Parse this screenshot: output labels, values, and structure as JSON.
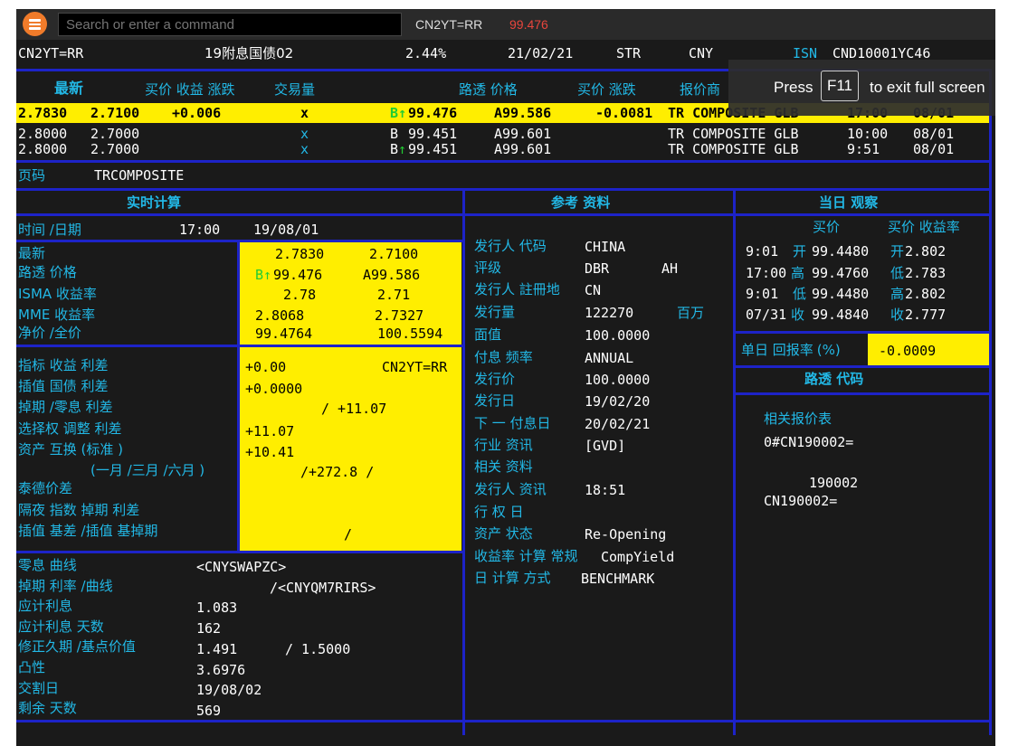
{
  "command_bar": {
    "placeholder": "Search or enter a command",
    "ric": "CN2YT=RR",
    "price": "99.476"
  },
  "fullscreen_hint": {
    "press": "Press",
    "key": "F11",
    "rest": "to exit full screen"
  },
  "header": {
    "ric": "CN2YT=RR",
    "name": "19附息国债02",
    "coupon": "2.44%",
    "maturity": "21/02/21",
    "str": "STR",
    "currency": "CNY",
    "isn_label": "ISN",
    "isn": "CND10001YC46"
  },
  "quote_headers": {
    "latest": "最新",
    "bid_yield_chg": "买价 收益 涨跌",
    "volume": "交易量",
    "reuters_price": "路透 价格",
    "bid_chg": "买价 涨跌",
    "contributor": "报价商"
  },
  "quotes": [
    {
      "bid": "2.7830",
      "ask": "2.7100",
      "chg": "+0.006",
      "vol": "x",
      "b_prefix": "B",
      "b_arrow": "↑",
      "b_price": "99.476",
      "a_price": "A99.586",
      "price_chg": "-0.0081",
      "source": "TR COMPOSITE GLB",
      "time": "17:00",
      "date": "08/01"
    },
    {
      "bid": "2.8000",
      "ask": "2.7000",
      "chg": "",
      "vol": "x",
      "b_prefix": "B",
      "b_arrow": "",
      "b_price": "99.451",
      "a_price": "A99.601",
      "price_chg": "",
      "source": "TR COMPOSITE GLB",
      "time": "10:00",
      "date": "08/01"
    },
    {
      "bid": "2.8000",
      "ask": "2.7000",
      "chg": "",
      "vol": "x",
      "b_prefix": "B",
      "b_arrow": "↑",
      "b_price": "99.451",
      "a_price": "A99.601",
      "price_chg": "",
      "source": "TR COMPOSITE GLB",
      "time": "9:51",
      "date": "08/01"
    }
  ],
  "page_code": {
    "label": "页码",
    "value": "TRCOMPOSITE"
  },
  "sections": {
    "realtime": "实时计算",
    "reference": "参考 资料",
    "daily": "当日 观察"
  },
  "realtime": {
    "time_label": "时间 /日期",
    "time": "17:00",
    "date": "19/08/01",
    "latest_label": "最新",
    "latest_bid": "2.7830",
    "latest_ask": "2.7100",
    "rp_label": "路透 价格",
    "rp_b": "B",
    "rp_arrow": "↑",
    "rp_bid": "99.476",
    "rp_ask": "A99.586",
    "isma_label": "ISMA 收益率",
    "isma_bid": "2.78",
    "isma_ask": "2.71",
    "mme_label": "MME  收益率",
    "mme_bid": "2.8068",
    "mme_ask": "2.7327",
    "net_label": "净价 /全价",
    "net": "99.4764",
    "full": "100.5594",
    "bench_label": "指标 收益 利差",
    "bench_value": "+0.00",
    "bench_ric": "CN2YT=RR",
    "interp_label": "插值 国债 利差",
    "interp_value": "+0.0000",
    "swap_label": "掉期 /零息 利差",
    "swap_value": "/  +11.07",
    "option_label": "选择权 调整 利差",
    "option_value": "+11.07",
    "asset_label": "资产 互换 (标准 )",
    "asset_value": "+10.41",
    "asset_sub_label": "(一月 /三月 /六月 )",
    "asset_sub_value": "/+272.8 /",
    "ted_label": "泰德价差",
    "overnight_label": "隔夜 指数 掉期 利差",
    "basis_label": "插值 基差 /插值 基掉期",
    "basis_value": "/",
    "zero_curve_label": "零息 曲线",
    "zero_curve": "<CNYSWAPZC>",
    "swap_curve_label": "掉期 利率 /曲线",
    "swap_curve": "/<CNYQM7RIRS>",
    "accrued_label": "应计利息",
    "accrued": "1.083",
    "accrued_days_label": "应计利息 天数",
    "accrued_days": "162",
    "duration_label": "修正久期 /基点价值",
    "duration": "1.491",
    "bpv": "/ 1.5000",
    "convexity_label": "凸性",
    "convexity": "3.6976",
    "settle_label": "交割日",
    "settle": "19/08/02",
    "remaining_label": "剩余 天数",
    "remaining": "569"
  },
  "reference": [
    {
      "label": "发行人 代码",
      "value": "CHINA",
      "extra": ""
    },
    {
      "label": "评级",
      "value": "DBR",
      "extra": "AH"
    },
    {
      "label": "发行人 註冊地",
      "value": "CN",
      "extra": ""
    },
    {
      "label": "发行量",
      "value": "122270",
      "extra": "百万"
    },
    {
      "label": "面值",
      "value": "100.0000",
      "extra": ""
    },
    {
      "label": "付息 频率",
      "value": "ANNUAL",
      "extra": ""
    },
    {
      "label": "发行价",
      "value": "100.0000",
      "extra": ""
    },
    {
      "label": "发行日",
      "value": "19/02/20",
      "extra": ""
    },
    {
      "label": "下 一 付息日",
      "value": "20/02/21",
      "extra": ""
    },
    {
      "label": "行业 资讯",
      "value": "[GVD]",
      "extra": ""
    },
    {
      "label": "相关 资料",
      "value": "",
      "extra": ""
    },
    {
      "label": "发行人 资讯",
      "value": "18:51",
      "extra": ""
    },
    {
      "label": "行 权 日",
      "value": "",
      "extra": ""
    },
    {
      "label": "资产  状态",
      "value": "Re-Opening",
      "extra": ""
    },
    {
      "label": "收益率 计算 常规",
      "value": "CompYield",
      "extra": ""
    },
    {
      "label": "日 计算 方式",
      "value": "BENCHMARK",
      "extra": ""
    }
  ],
  "daily": {
    "col_bid": "买价",
    "col_yield": "买价 收益率",
    "rows": [
      {
        "time": "9:01",
        "k1": "开",
        "v1": "99.4480",
        "k2": "开",
        "v2": "2.802"
      },
      {
        "time": "17:00",
        "k1": "高",
        "v1": "99.4760",
        "k2": "低",
        "v2": "2.783"
      },
      {
        "time": "9:01",
        "k1": "低",
        "v1": "99.4480",
        "k2": "高",
        "v2": "2.802"
      },
      {
        "time": "07/31",
        "k1": "收",
        "v1": "99.4840",
        "k2": "收",
        "v2": "2.777"
      }
    ],
    "return_label": "单日 回报率",
    "return_pct": "(%)",
    "return_value": "-0.0009",
    "reuters_code": "路透 代码",
    "related_label": "相关报价表",
    "related_value": "0#CN190002=",
    "code1": "190002",
    "code2": "CN190002="
  },
  "colors": {
    "yellow": "#ffee00",
    "blue": "#1d23c8",
    "cyan": "#22b8e6",
    "green": "#22cc33",
    "background": "#1a1a1a"
  }
}
